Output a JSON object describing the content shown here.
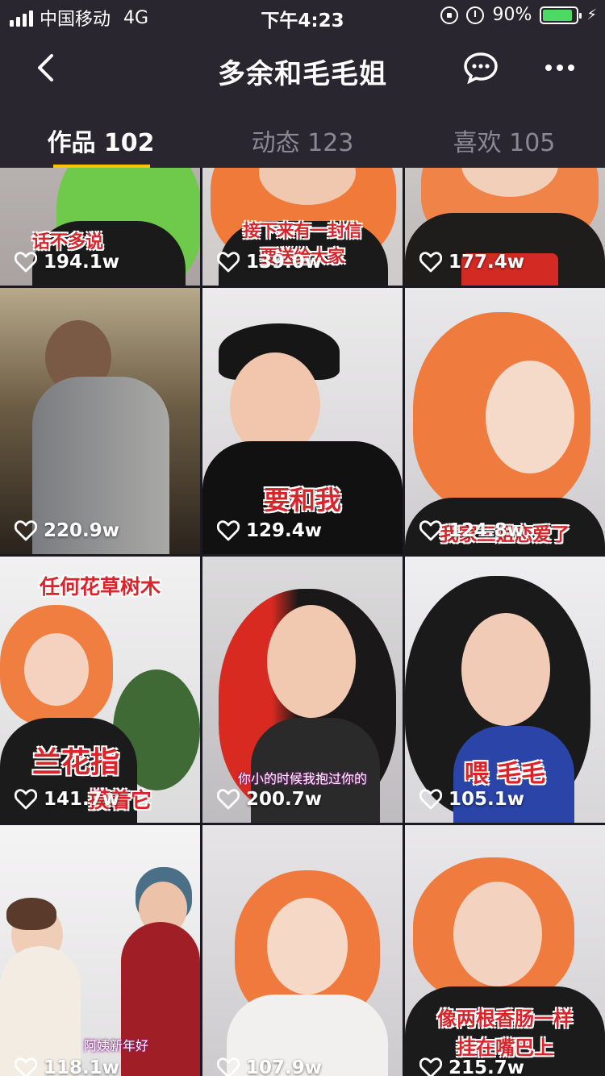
{
  "status_bar": {
    "carrier": "中国移动",
    "network": "4G",
    "time": "下午4:23",
    "battery_percent": "90%",
    "battery_level": 0.9,
    "battery_color": "#4cd964"
  },
  "nav": {
    "title": "多余和毛毛姐",
    "back_icon": "chevron-left-icon",
    "message_icon": "chat-bubble-icon",
    "more_icon": "more-dots-icon"
  },
  "tabs": [
    {
      "label": "作品 102",
      "active": true
    },
    {
      "label": "动态 123",
      "active": false
    },
    {
      "label": "喜欢 105",
      "active": false
    }
  ],
  "accent_color": "#f7c600",
  "videos": [
    {
      "likes": "194.1w",
      "caption": "话不多说"
    },
    {
      "likes": "139.0w",
      "caption": "接下来有一封信",
      "caption2": "要送给大家"
    },
    {
      "likes": "177.4w",
      "caption": ""
    },
    {
      "likes": "220.9w",
      "caption": ""
    },
    {
      "likes": "129.4w",
      "caption": "要和我"
    },
    {
      "likes": "124.8w",
      "caption": "我家三姐恋爱了"
    },
    {
      "likes": "141.7w",
      "caption": "任何花草树木",
      "caption2": "兰花指",
      "caption3": "摸着它"
    },
    {
      "likes": "200.7w",
      "caption": "你小的时候我抱过你的"
    },
    {
      "likes": "105.1w",
      "caption": "喂 毛毛"
    },
    {
      "likes": "118.1w",
      "caption": "阿姨新年好"
    },
    {
      "likes": "107.9w",
      "caption": ""
    },
    {
      "likes": "215.7w",
      "caption": "像两根香肠一样",
      "caption2": "挂在嘴巴上"
    }
  ]
}
